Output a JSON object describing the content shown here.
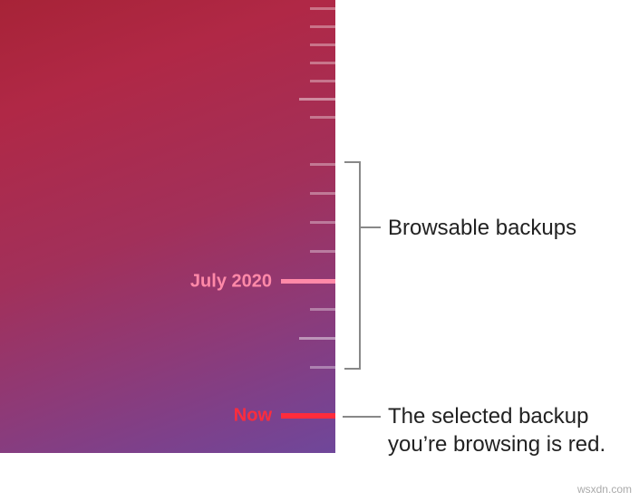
{
  "timeline": {
    "labeled_tick_text": "July 2020",
    "now_tick_text": "Now"
  },
  "annotations": {
    "browsable": "Browsable backups",
    "selected_line1": "The selected backup",
    "selected_line2": "you’re browsing is red."
  },
  "watermark": "wsxdn.com"
}
